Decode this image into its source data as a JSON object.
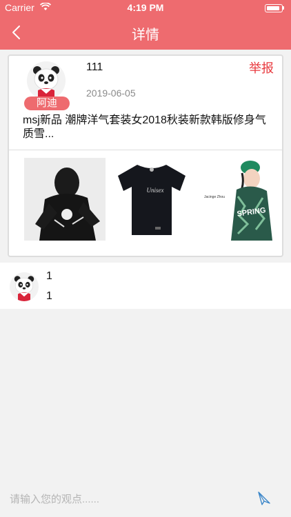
{
  "status": {
    "carrier": "Carrier",
    "time": "4:19 PM"
  },
  "nav": {
    "title": "详情",
    "back_icon": "chevron-left-icon"
  },
  "post": {
    "username": "111",
    "name_tag": "阿迪",
    "date": "2019-06-05",
    "report_label": "举报",
    "text": "msj新品 潮牌洋气套装女2018秋装新款韩版修身气质雪...",
    "images": [
      "person-black-tshirt",
      "black-tshirt",
      "spring-jacket-illustration"
    ],
    "tee_print": "Unisex",
    "jacket_print": "SPRING",
    "jacket_side_text": "Jacinge Zhou"
  },
  "comment": {
    "username": "1",
    "text": "1"
  },
  "input": {
    "placeholder": "请输入您的观点......",
    "send_icon": "send-icon"
  },
  "colors": {
    "accent": "#ee6b6f",
    "report": "#e8383d"
  }
}
